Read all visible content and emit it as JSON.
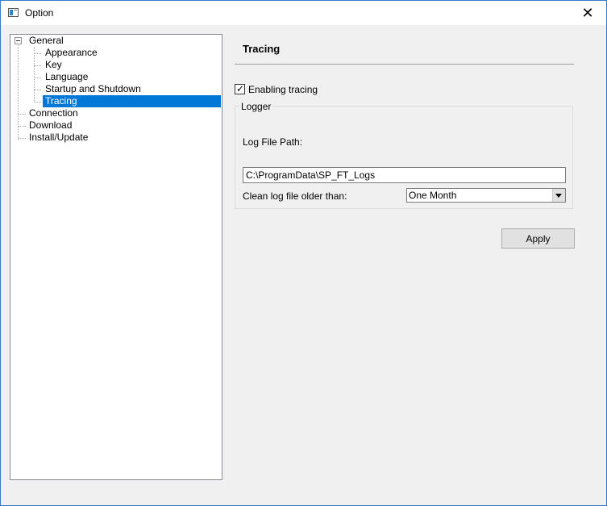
{
  "window": {
    "title": "Option",
    "close_glyph": "✕"
  },
  "tree": {
    "items": [
      {
        "label": "General"
      },
      {
        "label": "Appearance"
      },
      {
        "label": "Key"
      },
      {
        "label": "Language"
      },
      {
        "label": "Startup and Shutdown"
      },
      {
        "label": "Tracing"
      },
      {
        "label": "Connection"
      },
      {
        "label": "Download"
      },
      {
        "label": "Install/Update"
      }
    ],
    "selected": "Tracing"
  },
  "tracing": {
    "heading": "Tracing",
    "enable_label": "Enabling tracing",
    "enable_checked": true,
    "logger": {
      "legend": "Logger",
      "path_label": "Log File Path:",
      "path_value": "C:\\ProgramData\\SP_FT_Logs",
      "clean_label": "Clean log file older than:",
      "clean_value": "One Month"
    },
    "apply_label": "Apply"
  },
  "colors": {
    "selection": "#0078d7",
    "window_border": "#3b78c6"
  }
}
